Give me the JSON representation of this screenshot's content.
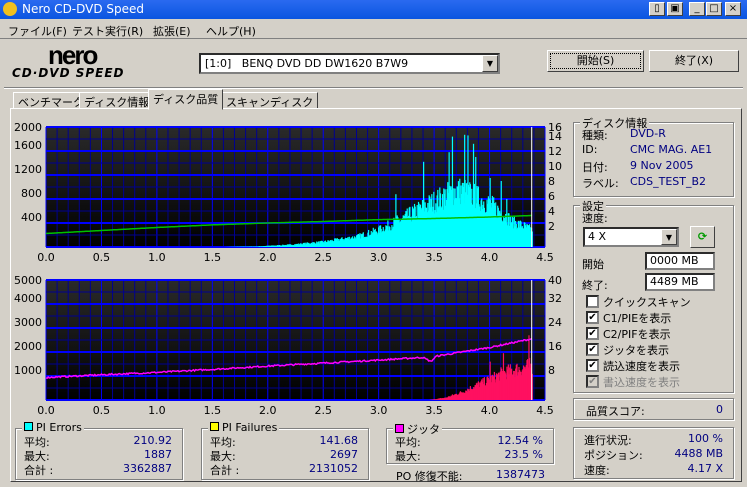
{
  "window": {
    "title": "Nero CD-DVD Speed"
  },
  "menu": [
    "ファイル(F)",
    "テスト実行(R)",
    "拡張(E)",
    "ヘルプ(H)"
  ],
  "logo": {
    "line1": "nero",
    "line2": "CD·DVD SPEED"
  },
  "drive": {
    "value": "[1:0]   BENQ DVD DD DW1620 B7W9"
  },
  "buttons": {
    "start": "開始(S)",
    "exit": "終了(X)"
  },
  "tabs": [
    "ベンチマーク",
    "ディスク情報",
    "ディスク品質",
    "スキャンディスク"
  ],
  "active_tab": 2,
  "disc_info": {
    "title": "ディスク情報",
    "rows": [
      {
        "label": "種類:",
        "value": "DVD-R"
      },
      {
        "label": "ID:",
        "value": "CMC MAG. AE1"
      },
      {
        "label": "日付:",
        "value": "9 Nov 2005"
      },
      {
        "label": "ラベル:",
        "value": "CDS_TEST_B2"
      }
    ]
  },
  "settings": {
    "title": "設定",
    "speed_label": "速度:",
    "speed_value": "4 X",
    "start_label": "開始",
    "start_value": "0000 MB",
    "end_label": "終了:",
    "end_value": "4489 MB",
    "checks": [
      {
        "label": "クイックスキャン",
        "checked": false,
        "disabled": false
      },
      {
        "label": "C1/PIEを表示",
        "checked": true,
        "disabled": false
      },
      {
        "label": "C2/PIFを表示",
        "checked": true,
        "disabled": false
      },
      {
        "label": "ジッタを表示",
        "checked": true,
        "disabled": false
      },
      {
        "label": "読込速度を表示",
        "checked": true,
        "disabled": false
      },
      {
        "label": "書込速度を表示",
        "checked": true,
        "disabled": true
      }
    ]
  },
  "quality": {
    "label": "品質スコア:",
    "value": "0"
  },
  "progress": {
    "rows": [
      {
        "label": "進行状況:",
        "value": "100 %"
      },
      {
        "label": "ポジション:",
        "value": "4488 MB"
      },
      {
        "label": "速度:",
        "value": "4.17 X"
      }
    ]
  },
  "pi_errors": {
    "title": "PI Errors",
    "color": "#00ffff",
    "rows": [
      {
        "label": "平均:",
        "value": "210.92"
      },
      {
        "label": "最大:",
        "value": "1887"
      },
      {
        "label": "合計 :",
        "value": "3362887"
      }
    ]
  },
  "pi_failures": {
    "title": "PI Failures",
    "color": "#ffff00",
    "rows": [
      {
        "label": "平均:",
        "value": "141.68"
      },
      {
        "label": "最大:",
        "value": "2697"
      },
      {
        "label": "合計 :",
        "value": "2131052"
      }
    ]
  },
  "jitter": {
    "title": "ジッタ",
    "color": "#ff00ff",
    "rows": [
      {
        "label": "平均:",
        "value": "12.54 %"
      },
      {
        "label": "最大:",
        "value": "23.5 %"
      }
    ]
  },
  "po": {
    "label": "PO 修復不能:",
    "value": "1387473"
  },
  "chart_data": [
    {
      "type": "bar",
      "name": "PI Errors / read speed",
      "xlim": [
        0,
        4.5
      ],
      "xticks": [
        "0.0",
        "0.5",
        "1.0",
        "1.5",
        "2.0",
        "2.5",
        "3.0",
        "3.5",
        "4.0",
        "4.5"
      ],
      "ylim": [
        0,
        2000
      ],
      "yticks": [
        "400",
        "800",
        "1200",
        "1600",
        "2000"
      ],
      "y2lim": [
        0,
        16
      ],
      "y2ticks": [
        "2",
        "4",
        "6",
        "8",
        "10",
        "12",
        "14",
        "16"
      ],
      "bars_color": "#00ffff",
      "bars_envelope": [
        [
          0,
          0
        ],
        [
          1.6,
          0
        ],
        [
          1.9,
          10
        ],
        [
          2.2,
          40
        ],
        [
          2.5,
          90
        ],
        [
          2.8,
          180
        ],
        [
          3.0,
          300
        ],
        [
          3.2,
          480
        ],
        [
          3.4,
          700
        ],
        [
          3.55,
          850
        ],
        [
          3.7,
          1000
        ],
        [
          3.8,
          950
        ],
        [
          4.0,
          750
        ],
        [
          4.2,
          450
        ],
        [
          4.38,
          300
        ]
      ],
      "bars_end": 4.38,
      "spikes": [
        [
          3.15,
          880
        ],
        [
          3.4,
          1420
        ],
        [
          3.63,
          1580
        ],
        [
          3.66,
          1840
        ],
        [
          3.77,
          1870
        ],
        [
          3.8,
          1860
        ],
        [
          3.85,
          1720
        ],
        [
          3.87,
          1500
        ],
        [
          4.0,
          1150
        ],
        [
          4.1,
          1100
        ],
        [
          4.15,
          800
        ]
      ],
      "line": {
        "name": "read speed",
        "color": "#00c000",
        "points": [
          [
            0,
            1.8
          ],
          [
            0.5,
            2.2
          ],
          [
            1.0,
            2.6
          ],
          [
            1.5,
            2.95
          ],
          [
            2.0,
            3.2
          ],
          [
            2.5,
            3.4
          ],
          [
            3.0,
            3.65
          ],
          [
            3.5,
            3.8
          ],
          [
            4.0,
            4.0
          ],
          [
            4.38,
            4.2
          ]
        ]
      }
    },
    {
      "type": "bar",
      "name": "PI Failures / jitter",
      "xlim": [
        0,
        4.5
      ],
      "xticks": [
        "0.0",
        "0.5",
        "1.0",
        "1.5",
        "2.0",
        "2.5",
        "3.0",
        "3.5",
        "4.0",
        "4.5"
      ],
      "ylim": [
        0,
        5000
      ],
      "yticks": [
        "1000",
        "2000",
        "3000",
        "4000",
        "5000"
      ],
      "y2lim": [
        0,
        40
      ],
      "y2ticks": [
        "8",
        "16",
        "24",
        "32",
        "40"
      ],
      "bars_color": "#ff1060",
      "bars_envelope": [
        [
          0,
          0
        ],
        [
          3.45,
          0
        ],
        [
          3.6,
          100
        ],
        [
          3.75,
          350
        ],
        [
          3.9,
          700
        ],
        [
          4.0,
          900
        ],
        [
          4.1,
          1150
        ],
        [
          4.2,
          1300
        ],
        [
          4.38,
          1500
        ]
      ],
      "bars_end": 4.38,
      "spikes": [
        [
          4.0,
          1600
        ],
        [
          4.12,
          1950
        ],
        [
          4.35,
          2697
        ]
      ],
      "line": {
        "name": "jitter",
        "color": "#ff00ff",
        "points": [
          [
            0,
            7.5
          ],
          [
            0.5,
            8.4
          ],
          [
            1.0,
            9.2
          ],
          [
            1.5,
            10.2
          ],
          [
            2.0,
            11.3
          ],
          [
            2.5,
            12.3
          ],
          [
            3.0,
            13.3
          ],
          [
            3.4,
            14.2
          ],
          [
            3.47,
            12.8
          ],
          [
            3.52,
            14.6
          ],
          [
            4.0,
            17.5
          ],
          [
            4.38,
            20.4
          ]
        ]
      }
    }
  ]
}
